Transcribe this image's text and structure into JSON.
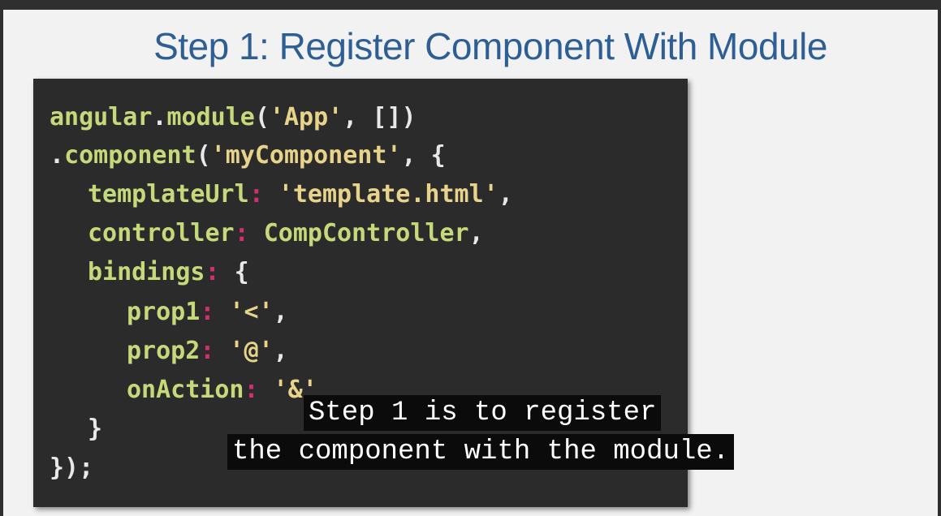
{
  "slide": {
    "title": "Step 1: Register Component With Module"
  },
  "code": {
    "l1_obj": "angular",
    "l1_dot": ".",
    "l1_fn": "module",
    "l1_open": "(",
    "l1_str": "'App'",
    "l1_rest": ", [])",
    "l2_dot": ".",
    "l2_fn": "component",
    "l2_open": "(",
    "l2_str": "'myComponent'",
    "l2_rest": ", {",
    "l3_key": "templateUrl",
    "l3_colon": ":",
    "l3_str": "'template.html'",
    "l3_rest": ",",
    "l4_key": "controller",
    "l4_colon": ":",
    "l4_val": "CompController",
    "l4_rest": ",",
    "l5_key": "bindings",
    "l5_colon": ":",
    "l5_rest": "{",
    "l6_key": "prop1",
    "l6_colon": ":",
    "l6_str": "'<'",
    "l6_rest": ",",
    "l7_key": "prop2",
    "l7_colon": ":",
    "l7_str": "'@'",
    "l7_rest": ",",
    "l8_key": "onAction",
    "l8_colon": ":",
    "l8_str": "'&'",
    "l9": "}",
    "l10": "});"
  },
  "captions": {
    "line1": "Step 1 is to register",
    "line2": "the component with the module."
  },
  "colors": {
    "title": "#2e5f94",
    "code_background": "#2b2b2b",
    "keyword": "#c6d97a",
    "string": "#e7d48a",
    "colon": "#d03070",
    "caption_background": "#0b0b0b"
  }
}
